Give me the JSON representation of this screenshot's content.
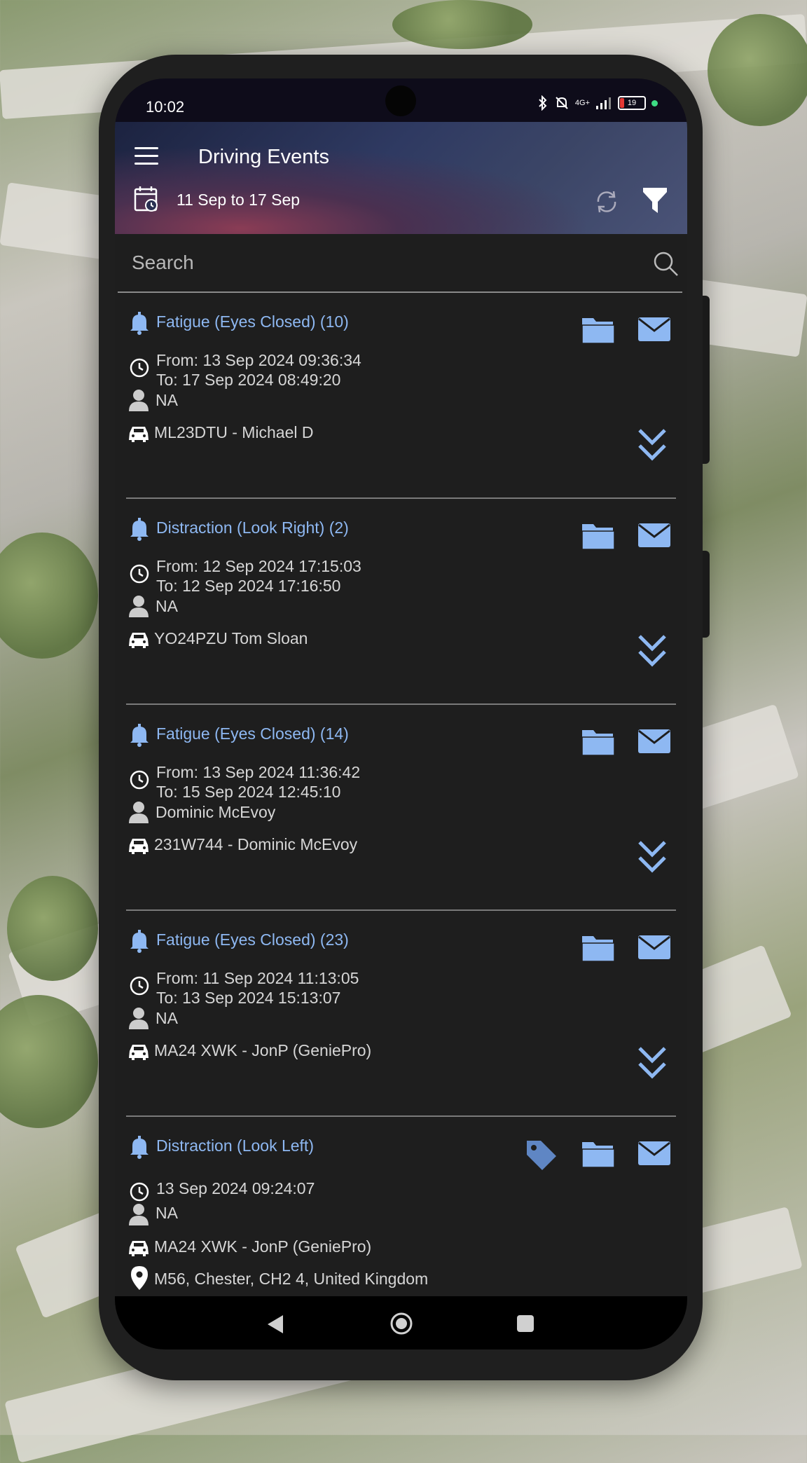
{
  "status_bar": {
    "time": "10:02",
    "network": "4G+",
    "battery": "19"
  },
  "header": {
    "title": "Driving Events",
    "date_range": "11 Sep to 17 Sep"
  },
  "search": {
    "placeholder": "Search"
  },
  "colors": {
    "accent": "#8eb8f2",
    "background": "#1e1e1e",
    "text": "#d6d6d6"
  },
  "events": [
    {
      "title": "Fatigue (Eyes Closed) (10)",
      "from": "From: 13 Sep 2024 09:36:34",
      "to": "To: 17 Sep 2024 08:49:20",
      "driver": "NA",
      "vehicle": "ML23DTU - Michael D"
    },
    {
      "title": "Distraction (Look Right) (2)",
      "from": "From: 12 Sep 2024 17:15:03",
      "to": "To: 12 Sep 2024 17:16:50",
      "driver": "NA",
      "vehicle": "YO24PZU Tom Sloan"
    },
    {
      "title": "Fatigue (Eyes Closed) (14)",
      "from": "From: 13 Sep 2024 11:36:42",
      "to": "To: 15 Sep 2024 12:45:10",
      "driver": "Dominic McEvoy",
      "vehicle": "231W744 - Dominic McEvoy"
    },
    {
      "title": "Fatigue (Eyes Closed) (23)",
      "from": "From: 11 Sep 2024 11:13:05",
      "to": "To: 13 Sep 2024 15:13:07",
      "driver": "NA",
      "vehicle": "MA24 XWK - JonP (GeniePro)"
    },
    {
      "title": "Distraction (Look Left)",
      "time": "13 Sep 2024 09:24:07",
      "driver": "NA",
      "vehicle": "MA24 XWK - JonP (GeniePro)",
      "location": "M56, Chester, CH2 4, United Kingdom"
    }
  ]
}
